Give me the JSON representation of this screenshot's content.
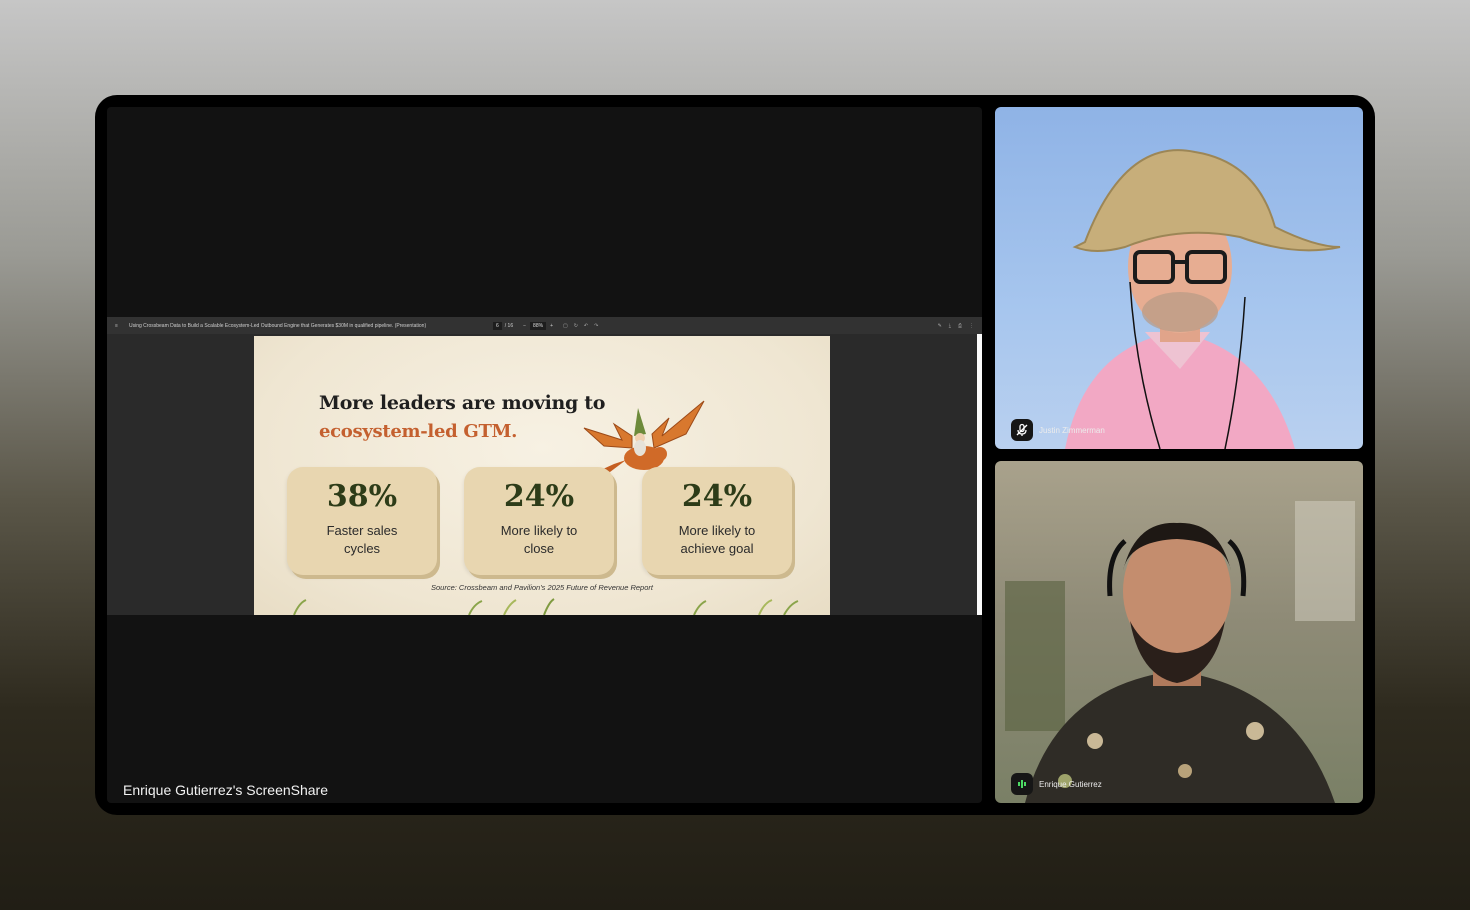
{
  "screenshare": {
    "label": "Enrique Gutierrez's ScreenShare",
    "viewer": {
      "menu_icon": "menu-icon",
      "doc_title": "Using Crossbeam Data to Build a Scalable Ecosystem-Led Outbound Engine that Generates $30M in qualified pipeline. (Presentation)",
      "page_current": "6",
      "page_total": "/ 16",
      "zoom": "88%",
      "zoom_out": "−",
      "zoom_in": "+"
    },
    "slide": {
      "heading_line1": "More leaders are moving to",
      "heading_line2": "ecosystem-led GTM.",
      "stats": [
        {
          "value": "38%",
          "label": "Faster sales cycles"
        },
        {
          "value": "24%",
          "label": "More likely to close"
        },
        {
          "value": "24%",
          "label": "More likely to achieve goal"
        }
      ],
      "source": "Source: Crossbeam and Pavilion's 2025 Future of Revenue Report"
    }
  },
  "participants": [
    {
      "name": "Justin Zimmerman",
      "status_icon": "mic-muted-icon"
    },
    {
      "name": "Enrique Gutierrez",
      "status_icon": "audio-active-icon"
    }
  ]
}
